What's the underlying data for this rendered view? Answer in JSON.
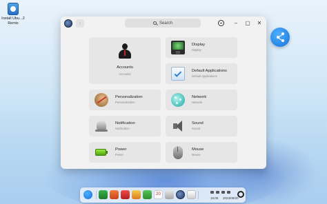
{
  "desktop": {
    "icon_label": "Install Ubu...2 Remix"
  },
  "window": {
    "search_placeholder": "Search",
    "back_glyph": "‹",
    "minimize_glyph": "–",
    "maximize_glyph": "▢",
    "close_glyph": "✕"
  },
  "settings": [
    {
      "name": "Accounts",
      "sub": "Accounts",
      "icon": "user-icon"
    },
    {
      "name": "Display",
      "sub": "Display",
      "icon": "monitor-icon"
    },
    {
      "name": "Default Applications",
      "sub": "Default Applications",
      "icon": "default-apps-icon"
    },
    {
      "name": "Personalization",
      "sub": "Personalization",
      "icon": "palette-icon"
    },
    {
      "name": "Network",
      "sub": "Network",
      "icon": "globe-network-icon"
    },
    {
      "name": "Notification",
      "sub": "Notification",
      "icon": "bell-icon"
    },
    {
      "name": "Sound",
      "sub": "Sound",
      "icon": "speaker-icon"
    },
    {
      "name": "Power",
      "sub": "Power",
      "icon": "battery-icon"
    },
    {
      "name": "Mouse",
      "sub": "Mouse",
      "icon": "mouse-icon"
    }
  ],
  "dock": {
    "time": "15:05",
    "date": "2023/08/20",
    "calendar_day": "20",
    "colors": {
      "launcher": "#1571d9"
    }
  }
}
